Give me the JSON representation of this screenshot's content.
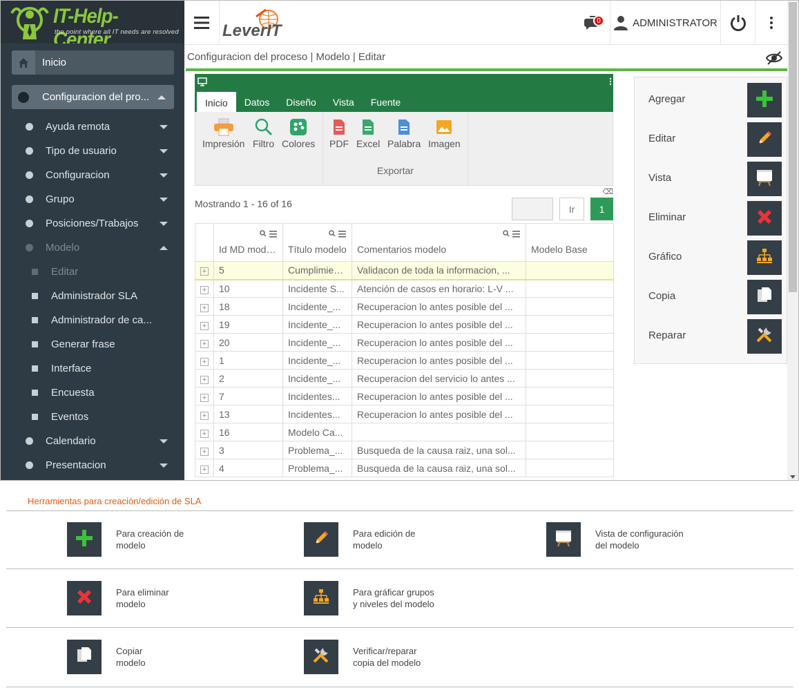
{
  "brand": {
    "title": "IT-Help-Center",
    "subtitle": "the point where all IT needs are resolved",
    "partner_logo": "LeverIT"
  },
  "sidebar": {
    "inicio": "Inicio",
    "config": "Configuracion del pro...",
    "items": [
      {
        "label": "Ayuda remota",
        "kind": "dot",
        "caret": "down"
      },
      {
        "label": "Tipo de usuario",
        "kind": "dot",
        "caret": "down"
      },
      {
        "label": "Configuracion",
        "kind": "dot",
        "caret": "down"
      },
      {
        "label": "Grupo",
        "kind": "dot",
        "caret": "down"
      },
      {
        "label": "Posiciones/Trabajos",
        "kind": "dot",
        "caret": "down"
      },
      {
        "label": "Modelo",
        "kind": "dot",
        "caret": "up",
        "muted": true
      },
      {
        "label": "Editar",
        "kind": "square",
        "muted": true
      },
      {
        "label": "Administrador SLA",
        "kind": "square"
      },
      {
        "label": "Administrador de ca...",
        "kind": "square"
      },
      {
        "label": "Generar frase",
        "kind": "square"
      },
      {
        "label": "Interface",
        "kind": "square"
      },
      {
        "label": "Encuesta",
        "kind": "square"
      },
      {
        "label": "Eventos",
        "kind": "square"
      },
      {
        "label": "Calendario",
        "kind": "dot",
        "caret": "down"
      },
      {
        "label": "Presentacion",
        "kind": "dot",
        "caret": "down"
      }
    ]
  },
  "topbar": {
    "notifications": "0",
    "user": "ADMINISTRATOR"
  },
  "breadcrumb": "Configuracion del proceso | Modelo | Editar",
  "ribbon": {
    "tabs": [
      "Inicio",
      "Datos",
      "Diseño",
      "Vista",
      "Fuente"
    ],
    "active_tab": "Inicio",
    "buttons": [
      "Impresión",
      "Filtro",
      "Colores"
    ],
    "export_buttons": [
      "PDF",
      "Excel",
      "Palabra",
      "Imagen"
    ],
    "export_group": "Exportar"
  },
  "grid": {
    "showing": "Mostrando 1 - 16 of 16",
    "go_label": "Ir",
    "current_page": "1",
    "columns": [
      "Id MD modelo",
      "Título modelo",
      "Comentarios modelo",
      "Modelo Base"
    ],
    "rows": [
      [
        "5",
        "Cumplimiento",
        "Validacon de toda la informacion, ...",
        ""
      ],
      [
        "10",
        "Incidente S...",
        "Atención de casos en horario: L-V ...",
        ""
      ],
      [
        "18",
        "Incidente_...",
        "Recuperacion lo antes posible del ...",
        ""
      ],
      [
        "19",
        "Incidente_...",
        "Recuperacion lo antes posible del ...",
        ""
      ],
      [
        "20",
        "Incidente_...",
        "Recuperacion lo antes posible del ...",
        ""
      ],
      [
        "1",
        "Incidente_...",
        "Recuperacion lo antes posible del ...",
        ""
      ],
      [
        "2",
        "Incidente_...",
        "Recuperacion del servicio lo antes ...",
        ""
      ],
      [
        "7",
        "Incidentes...",
        "Recuperacion lo antes posible del ...",
        ""
      ],
      [
        "13",
        "Incidentes...",
        "Recuperacion lo antes posible del ...",
        ""
      ],
      [
        "16",
        "Modelo Ca...",
        "",
        ""
      ],
      [
        "3",
        "Problema_...",
        "Busqueda de la causa raiz, una sol...",
        ""
      ],
      [
        "4",
        "Problema_...",
        "Busqueda de la causa raiz, una sol...",
        ""
      ]
    ]
  },
  "actions": [
    {
      "label": "Agregar",
      "icon": "plus-icon"
    },
    {
      "label": "Editar",
      "icon": "pencil-icon"
    },
    {
      "label": "Vista",
      "icon": "board-icon"
    },
    {
      "label": "Eliminar",
      "icon": "x-icon"
    },
    {
      "label": "Gráfico",
      "icon": "hierarchy-icon"
    },
    {
      "label": "Copia",
      "icon": "copy-icon"
    },
    {
      "label": "Reparar",
      "icon": "tools-icon"
    }
  ],
  "legend": {
    "title": "Herramientas para creación/edición de SLA",
    "items": [
      {
        "text": "Para creación de\nmodelo",
        "icon": "plus-icon"
      },
      {
        "text": "Para edición de\nmodelo",
        "icon": "pencil-icon"
      },
      {
        "text": "Vista de configuración\ndel modelo",
        "icon": "board-icon"
      },
      {
        "text": "Para eliminar\nmodelo",
        "icon": "x-icon"
      },
      {
        "text": "Para gráficar grupos\ny niveles del modelo",
        "icon": "hierarchy-icon"
      },
      {
        "text": "Copiar\nmodelo",
        "icon": "copy-icon"
      },
      {
        "text": "Verificar/reparar\ncopia del modelo",
        "icon": "tools-icon"
      }
    ]
  },
  "colors": {
    "accent_green": "#5cb545",
    "ribbon_green": "#247a43",
    "sidebar": "#2f3b44",
    "orange": "#e25a10"
  }
}
